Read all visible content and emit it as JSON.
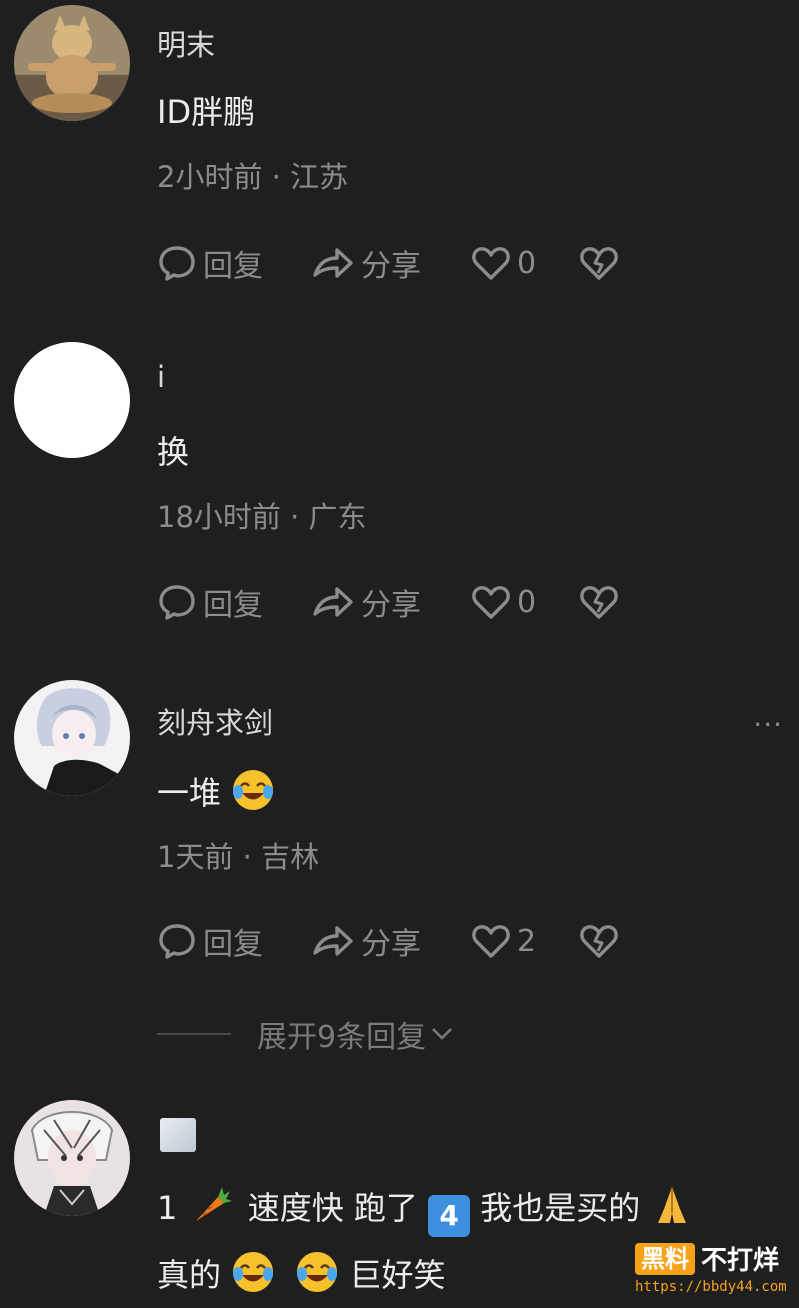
{
  "comments": [
    {
      "username": "明末",
      "text": "ID胖鹏",
      "meta": "2小时前 · 江苏",
      "reply_label": "回复",
      "share_label": "分享",
      "likes": "0"
    },
    {
      "username": "i",
      "text": "换",
      "meta": "18小时前 · 广东",
      "reply_label": "回复",
      "share_label": "分享",
      "likes": "0"
    },
    {
      "username": "刻舟求剑",
      "text": "一堆",
      "meta": "1天前 · 吉林",
      "reply_label": "回复",
      "share_label": "分享",
      "likes": "2",
      "more_label": "···",
      "expand_label": "展开9条回复"
    },
    {
      "username": "",
      "text_line1": [
        "1",
        "速度快 跑了",
        "4",
        "我也是买的"
      ],
      "text_line2": [
        "真的",
        "巨好笑"
      ]
    }
  ],
  "watermark": {
    "brand_box": "黑料",
    "brand_text": "不打烊",
    "url": "https://bbdy44.com"
  },
  "colors": {
    "background": "#1f1f1f",
    "text_primary": "#ececec",
    "text_secondary": "#8c8c8c",
    "brand_orange": "#f6a21a"
  },
  "icons": [
    "comment-bubble-icon",
    "share-arrow-icon",
    "heart-icon",
    "broken-heart-icon",
    "chevron-down-icon",
    "more-dots-icon",
    "cry-laugh-emoji",
    "carrot-emoji",
    "pray-emoji"
  ]
}
